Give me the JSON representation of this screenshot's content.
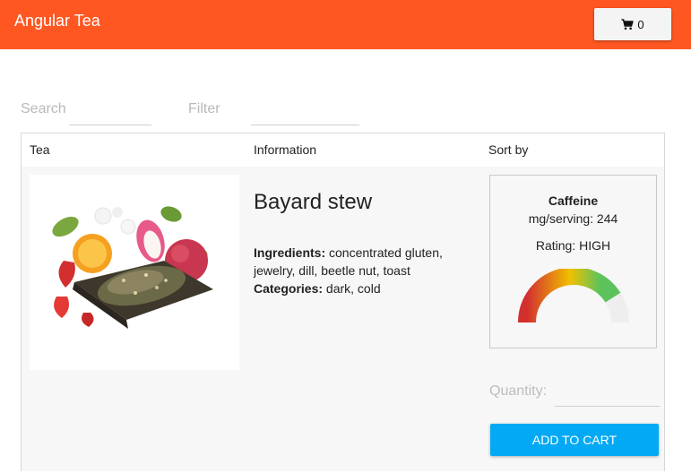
{
  "app": {
    "title": "Angular Tea"
  },
  "cart": {
    "count": "0",
    "icon": "shopping-cart-icon"
  },
  "search": {
    "label": "Search",
    "value": ""
  },
  "filter": {
    "label": "Filter",
    "value": ""
  },
  "table": {
    "headers": {
      "tea": "Tea",
      "information": "Information",
      "sort": "Sort by"
    }
  },
  "product": {
    "name": "Bayard stew",
    "ingredients_label": "Ingredients:",
    "ingredients": "concentrated gluten, jewelry, dill, beetle nut, toast",
    "categories_label": "Categories:",
    "categories": "dark, cold",
    "caffeine": {
      "title": "Caffeine",
      "mg_text": "mg/serving: 244",
      "rating_text": "Rating: HIGH",
      "gauge_fraction": 0.82
    },
    "quantity": {
      "label": "Quantity:",
      "value": ""
    },
    "add_to_cart_label": "Add to cart"
  },
  "colors": {
    "brand": "#ff5722",
    "accent": "#03a9f4",
    "gauge_red": "#d32f2f",
    "gauge_yellow": "#f0c000",
    "gauge_green": "#5cc35c",
    "gauge_track": "#eeeeee"
  }
}
